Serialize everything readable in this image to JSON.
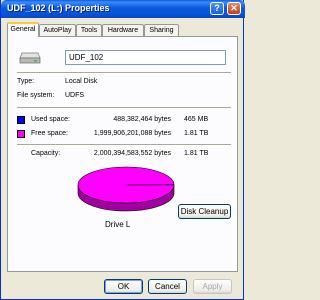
{
  "window": {
    "title": "UDF_102 (L:) Properties",
    "help_label": "?",
    "close_label": "✕"
  },
  "tabs": [
    {
      "label": "General",
      "active": true
    },
    {
      "label": "AutoPlay",
      "active": false
    },
    {
      "label": "Tools",
      "active": false
    },
    {
      "label": "Hardware",
      "active": false
    },
    {
      "label": "Sharing",
      "active": false
    }
  ],
  "general": {
    "drive_icon": "drive-icon",
    "volume_label": "UDF_102",
    "type_label": "Type:",
    "type_value": "Local Disk",
    "fs_label": "File system:",
    "fs_value": "UDFS",
    "used_label": "Used space:",
    "used_bytes": "488,382,464 bytes",
    "used_size": "465 MB",
    "used_color": "#0000ff",
    "free_label": "Free space:",
    "free_bytes": "1,999,906,201,088 bytes",
    "free_size": "1.81 TB",
    "free_color": "#ff00ff",
    "capacity_label": "Capacity:",
    "capacity_bytes": "2,000,394,583,552 bytes",
    "capacity_size": "1.81 TB",
    "drive_name": "Drive L",
    "disk_cleanup_label": "Disk Cleanup",
    "used_fraction": 0.000244
  },
  "buttons": {
    "ok": "OK",
    "cancel": "Cancel",
    "apply": "Apply"
  }
}
